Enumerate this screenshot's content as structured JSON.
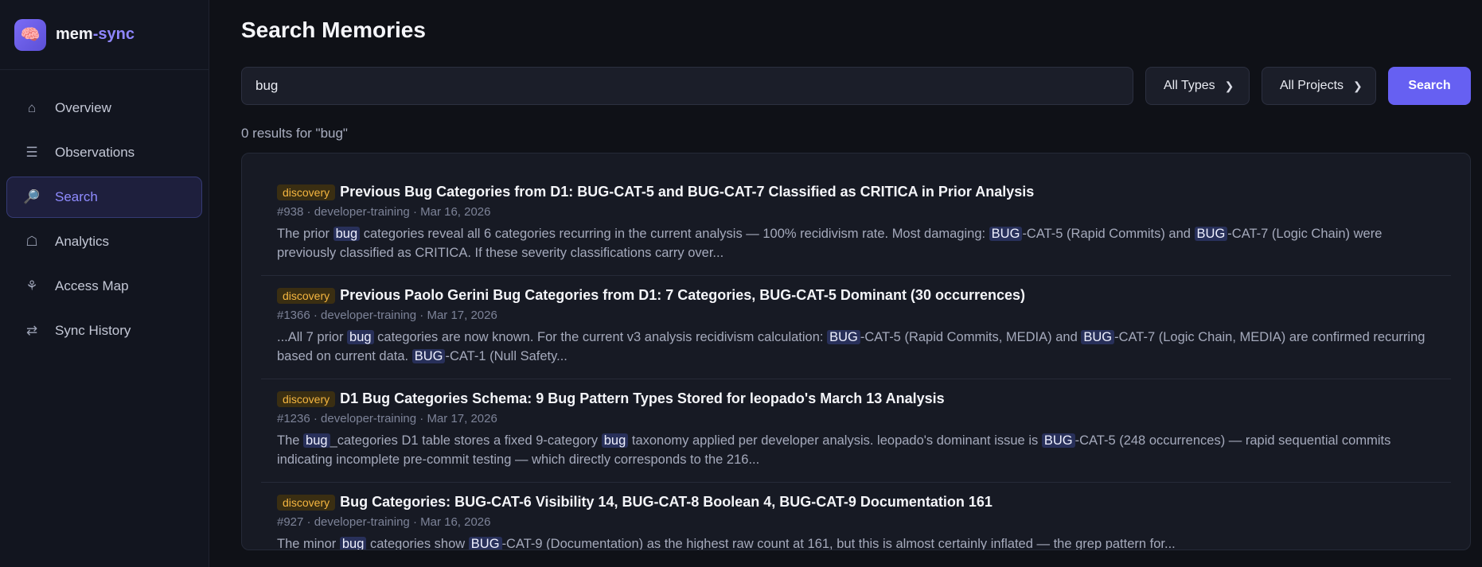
{
  "brand": {
    "logo_icon": "brain-icon",
    "name_part1": "mem",
    "name_part2": "-sync"
  },
  "sidebar": {
    "items": [
      {
        "label": "Overview",
        "icon": "⌂",
        "icon_name": "home-icon",
        "active": false
      },
      {
        "label": "Observations",
        "icon": "☰",
        "icon_name": "list-icon",
        "active": false
      },
      {
        "label": "Search",
        "icon": "🔎",
        "icon_name": "search-icon",
        "active": true
      },
      {
        "label": "Analytics",
        "icon": "☖",
        "icon_name": "analytics-icon",
        "active": false
      },
      {
        "label": "Access Map",
        "icon": "⚘",
        "icon_name": "map-icon",
        "active": false
      },
      {
        "label": "Sync History",
        "icon": "⇄",
        "icon_name": "sync-icon",
        "active": false
      }
    ]
  },
  "main": {
    "title": "Search Memories",
    "search": {
      "value": "bug",
      "placeholder": ""
    },
    "type_filter": "All Types",
    "project_filter": "All Projects",
    "search_button": "Search",
    "result_count": "0 results for \"bug\""
  },
  "results": [
    {
      "badge": "discovery",
      "title": "Previous Bug Categories from D1: BUG-CAT-5 and BUG-CAT-7 Classified as CRITICA in Prior Analysis",
      "meta": "#938 · developer-training · Mar 16, 2026",
      "snippet": [
        {
          "t": "The prior "
        },
        {
          "t": "bug",
          "h": true
        },
        {
          "t": " categories reveal all 6 categories recurring in the current analysis — 100% recidivism rate. Most damaging: "
        },
        {
          "t": "BUG",
          "h": true
        },
        {
          "t": "-CAT-5 (Rapid Commits) and "
        },
        {
          "t": "BUG",
          "h": true
        },
        {
          "t": "-CAT-7 (Logic Chain) were previously classified as CRITICA. If these severity classifications carry over..."
        }
      ]
    },
    {
      "badge": "discovery",
      "title": "Previous Paolo Gerini Bug Categories from D1: 7 Categories, BUG-CAT-5 Dominant (30 occurrences)",
      "meta": "#1366 · developer-training · Mar 17, 2026",
      "snippet": [
        {
          "t": "...All 7 prior "
        },
        {
          "t": "bug",
          "h": true
        },
        {
          "t": " categories are now known. For the current v3 analysis recidivism calculation: "
        },
        {
          "t": "BUG",
          "h": true
        },
        {
          "t": "-CAT-5 (Rapid Commits, MEDIA) and "
        },
        {
          "t": "BUG",
          "h": true
        },
        {
          "t": "-CAT-7 (Logic Chain, MEDIA) are confirmed recurring based on current data. "
        },
        {
          "t": "BUG",
          "h": true
        },
        {
          "t": "-CAT-1 (Null Safety..."
        }
      ]
    },
    {
      "badge": "discovery",
      "title": "D1 Bug Categories Schema: 9 Bug Pattern Types Stored for leopado's March 13 Analysis",
      "meta": "#1236 · developer-training · Mar 17, 2026",
      "snippet": [
        {
          "t": "The "
        },
        {
          "t": "bug",
          "h": true
        },
        {
          "t": "_categories D1 table stores a fixed 9-category "
        },
        {
          "t": "bug",
          "h": true
        },
        {
          "t": " taxonomy applied per developer analysis. leopado's dominant issue is "
        },
        {
          "t": "BUG",
          "h": true
        },
        {
          "t": "-CAT-5 (248 occurrences) — rapid sequential commits indicating incomplete pre-commit testing — which directly corresponds to the 216..."
        }
      ]
    },
    {
      "badge": "discovery",
      "title": "Bug Categories: BUG-CAT-6 Visibility 14, BUG-CAT-8 Boolean 4, BUG-CAT-9 Documentation 161",
      "meta": "#927 · developer-training · Mar 16, 2026",
      "snippet": [
        {
          "t": "The minor "
        },
        {
          "t": "bug",
          "h": true
        },
        {
          "t": " categories show "
        },
        {
          "t": "BUG",
          "h": true
        },
        {
          "t": "-CAT-9 (Documentation) as the highest raw count at 161, but this is almost certainly inflated — the grep pattern for..."
        }
      ]
    }
  ]
}
